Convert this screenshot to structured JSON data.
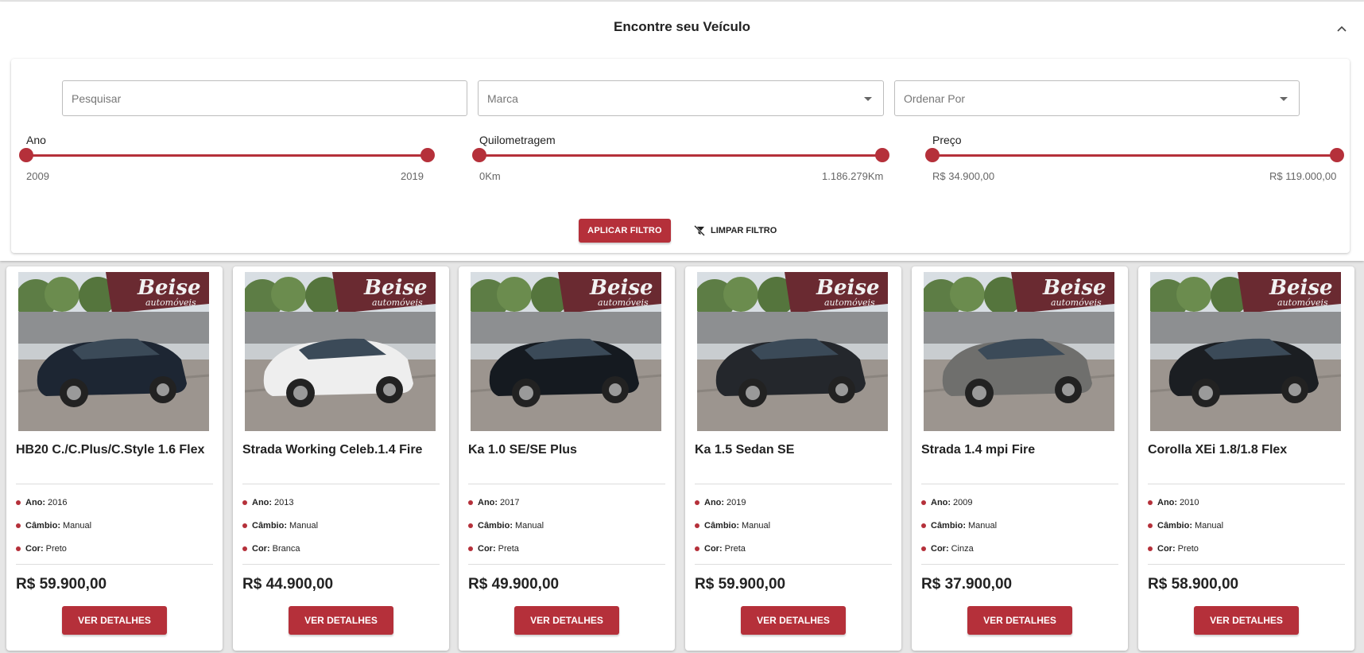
{
  "filter": {
    "title": "Encontre seu Veículo",
    "search_placeholder": "Pesquisar",
    "brand_placeholder": "Marca",
    "sort_placeholder": "Ordenar Por",
    "year": {
      "label": "Ano",
      "min": "2009",
      "max": "2019"
    },
    "km": {
      "label": "Quilometragem",
      "min": "0Km",
      "max": "1.186.279Km"
    },
    "price": {
      "label": "Preço",
      "min": "R$ 34.900,00",
      "max": "R$ 119.000,00"
    },
    "apply_label": "APLICAR FILTRO",
    "clear_label": "LIMPAR FILTRO"
  },
  "labels": {
    "year": "Ano:",
    "gear": "Câmbio:",
    "color": "Cor:",
    "details": "VER DETALHES"
  },
  "brand_watermark": "Beise automóveis",
  "colors": {
    "accent": "#b5303a"
  },
  "cars": [
    {
      "title": "HB20 C./C.Plus/C.Style 1.6 Flex",
      "year": "2016",
      "gear": "Manual",
      "color": "Preto",
      "price": "R$ 59.900,00"
    },
    {
      "title": "Strada Working Celeb.1.4 Fire",
      "year": "2013",
      "gear": "Manual",
      "color": "Branca",
      "price": "R$ 44.900,00"
    },
    {
      "title": "Ka 1.0 SE/SE Plus",
      "year": "2017",
      "gear": "Manual",
      "color": "Preta",
      "price": "R$ 49.900,00"
    },
    {
      "title": "Ka 1.5 Sedan SE",
      "year": "2019",
      "gear": "Manual",
      "color": "Preta",
      "price": "R$ 59.900,00"
    },
    {
      "title": "Strada 1.4 mpi Fire",
      "year": "2009",
      "gear": "Manual",
      "color": "Cinza",
      "price": "R$ 37.900,00"
    },
    {
      "title": "Corolla XEi 1.8/1.8 Flex",
      "year": "2010",
      "gear": "Manual",
      "color": "Preto",
      "price": "R$ 58.900,00"
    }
  ]
}
